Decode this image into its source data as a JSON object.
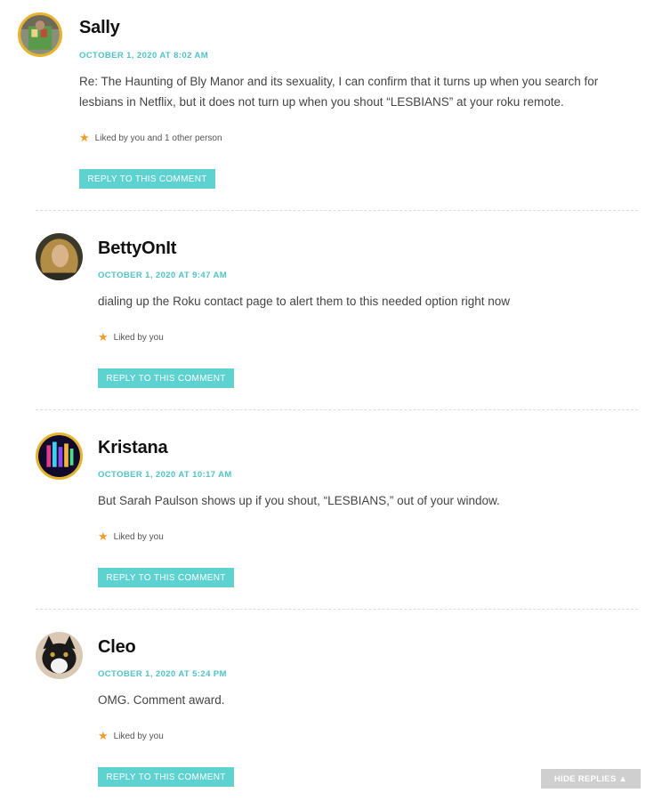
{
  "comments": [
    {
      "author": "Sally",
      "date": "OCTOBER 1, 2020 AT 8:02 AM",
      "text": "Re: The Haunting of Bly Manor and its sexuality, I can confirm that it turns up when you search for lesbians in Netflix, but it does not turn up when you shout “LESBIANS” at your roku remote.",
      "likes": "Liked by you and 1 other person",
      "reply_label": "REPLY TO THIS COMMENT",
      "avatar_icon": "user-avatar"
    },
    {
      "author": "BettyOnIt",
      "date": "OCTOBER 1, 2020 AT 9:47 AM",
      "text": "dialing up the Roku contact page to alert them to this needed option right now",
      "likes": "Liked by you",
      "reply_label": "REPLY TO THIS COMMENT",
      "avatar_icon": "user-avatar"
    },
    {
      "author": "Kristana",
      "date": "OCTOBER 1, 2020 AT 10:17 AM",
      "text": "But Sarah Paulson shows up if you shout, “LESBIANS,” out of your window.",
      "likes": "Liked by you",
      "reply_label": "REPLY TO THIS COMMENT",
      "avatar_icon": "user-avatar"
    },
    {
      "author": "Cleo",
      "date": "OCTOBER 1, 2020 AT 5:24 PM",
      "text": "OMG. Comment award.",
      "likes": "Liked by you",
      "reply_label": "REPLY TO THIS COMMENT",
      "avatar_icon": "user-avatar"
    }
  ],
  "hide_replies_label": "HIDE REPLIES ▲",
  "colors": {
    "accent": "#5ed1d1",
    "date": "#4fc3c7",
    "star": "#f39a2b",
    "avatar_ring": "#e7b32a"
  }
}
